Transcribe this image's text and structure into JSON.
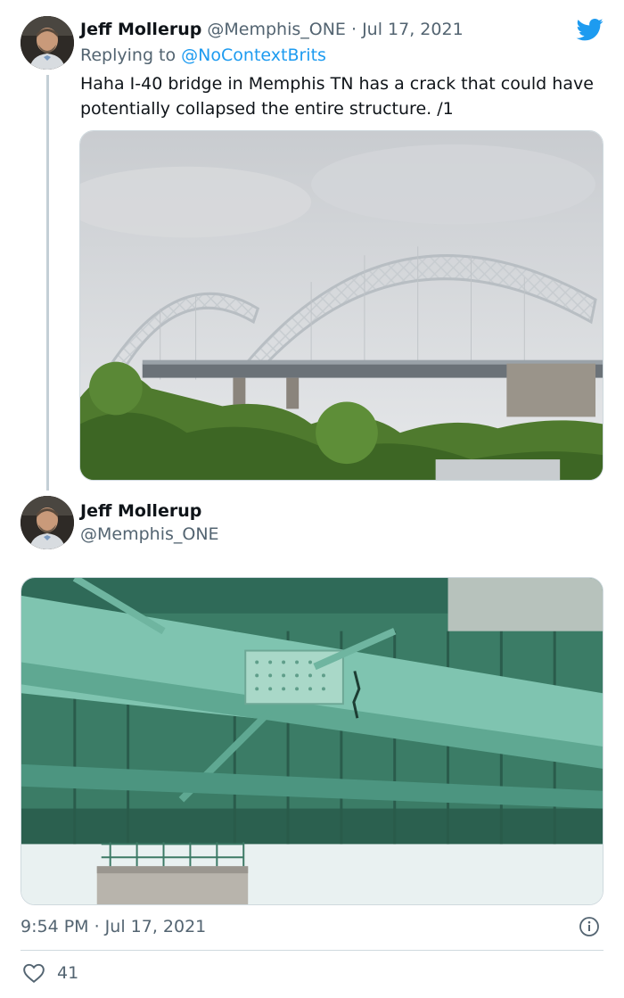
{
  "tweet1": {
    "name": "Jeff Mollerup",
    "handle": "@Memphis_ONE",
    "separator": "·",
    "date": "Jul 17, 2021",
    "reply_prefix": "Replying to",
    "reply_to": "@NoContextBrits",
    "text": "Haha I-40 bridge in Memphis TN has a crack that could have potentially collapsed the entire structure. /1",
    "avatar_icon": "avatar-photo",
    "logo_icon": "twitter-bird-icon"
  },
  "tweet2": {
    "name": "Jeff Mollerup",
    "handle": "@Memphis_ONE",
    "avatar_icon": "avatar-photo"
  },
  "footer": {
    "timestamp": "9:54 PM · Jul 17, 2021",
    "info_icon": "info-icon",
    "like_icon": "heart-icon",
    "like_count": "41"
  },
  "colors": {
    "text": "#0f1419",
    "secondary": "#536471",
    "link": "#1d9bf0",
    "border": "#cfd9de"
  }
}
